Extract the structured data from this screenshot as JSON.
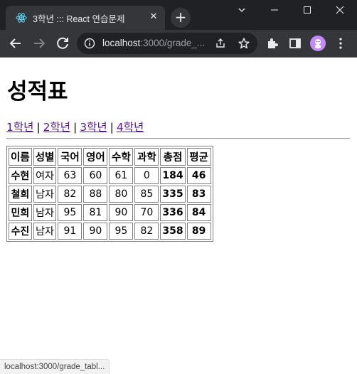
{
  "browser": {
    "tab_title": "3학년 ::: React 연습문제",
    "tab_close": "✕",
    "new_tab": "+",
    "url_host": "localhost",
    "url_path": ":3000/grade_...",
    "avatar_color": "#c58af9",
    "favicon_color": "#61dafb"
  },
  "page": {
    "title": "성적표",
    "nav": [
      {
        "label": "1학년"
      },
      {
        "label": "2학년"
      },
      {
        "label": "3학년"
      },
      {
        "label": "4학년"
      }
    ],
    "nav_separator": "|"
  },
  "table": {
    "headers": [
      "이름",
      "성별",
      "국어",
      "영어",
      "수학",
      "과학",
      "총점",
      "평균"
    ],
    "rows": [
      [
        "수현",
        "여자",
        "63",
        "60",
        "61",
        "0",
        "184",
        "46"
      ],
      [
        "철희",
        "남자",
        "82",
        "88",
        "80",
        "85",
        "335",
        "83"
      ],
      [
        "민희",
        "남자",
        "95",
        "81",
        "90",
        "70",
        "336",
        "84"
      ],
      [
        "수진",
        "남자",
        "91",
        "90",
        "95",
        "82",
        "358",
        "89"
      ]
    ]
  },
  "status_bar": {
    "text": "localhost:3000/grade_tabl..."
  }
}
